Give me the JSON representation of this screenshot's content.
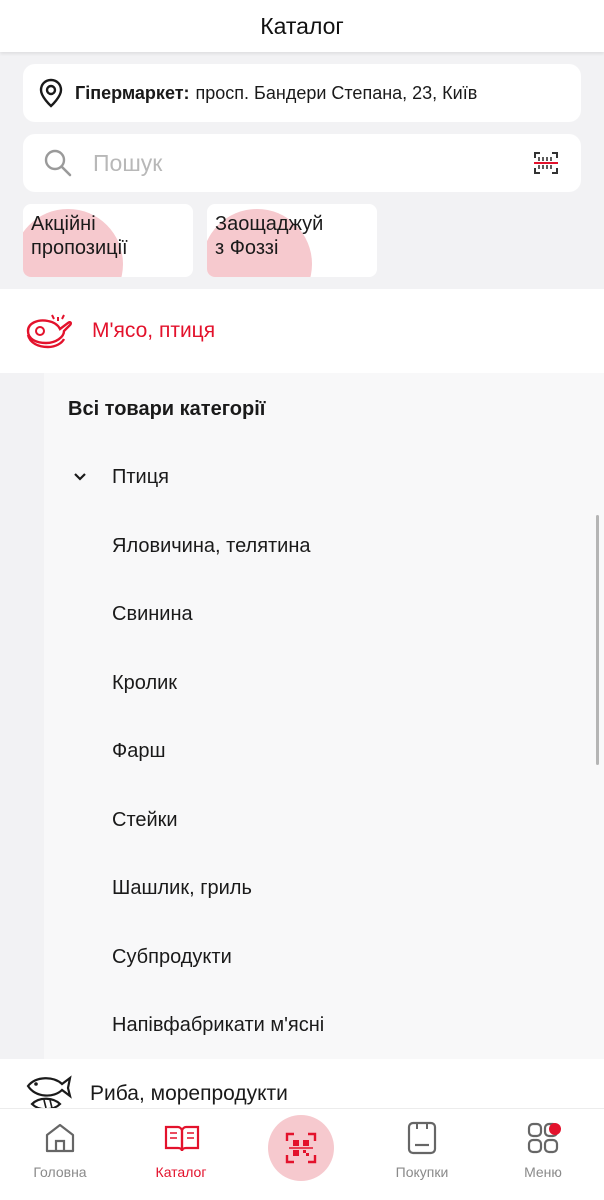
{
  "header": {
    "title": "Каталог"
  },
  "store": {
    "label": "Гіпермаркет:",
    "address": "просп. Бандери Степана, 23, Київ"
  },
  "search": {
    "placeholder": "Пошук"
  },
  "promos": [
    {
      "label": "Акційні пропозиції"
    },
    {
      "label": "Заощаджуй з Фоззі"
    }
  ],
  "category": {
    "name": "М'ясо, птиця",
    "all_items": "Всі товари категорії",
    "subcategories": [
      "Птиця",
      "Яловичина, телятина",
      "Свинина",
      "Кролик",
      "Фарш",
      "Стейки",
      "Шашлик, гриль",
      "Субпродукти",
      "Напівфабрикати м'ясні"
    ]
  },
  "next_category": {
    "name": "Риба, морепродукти"
  },
  "tabbar": {
    "tabs": [
      {
        "label": "Головна"
      },
      {
        "label": "Каталог"
      },
      {
        "label": "Покупки"
      },
      {
        "label": "Меню"
      }
    ],
    "active_tab": "Каталог"
  },
  "colors": {
    "accent": "#e3122c",
    "accent_light": "#f6c9ce",
    "background": "#f2f2f4"
  },
  "icons": [
    "location-pin-icon",
    "search-icon",
    "barcode-scan-icon",
    "meat-icon",
    "fish-icon",
    "home-icon",
    "catalog-book-icon",
    "scan-qr-icon",
    "receipt-icon",
    "menu-grid-icon",
    "chevron-down-icon"
  ]
}
